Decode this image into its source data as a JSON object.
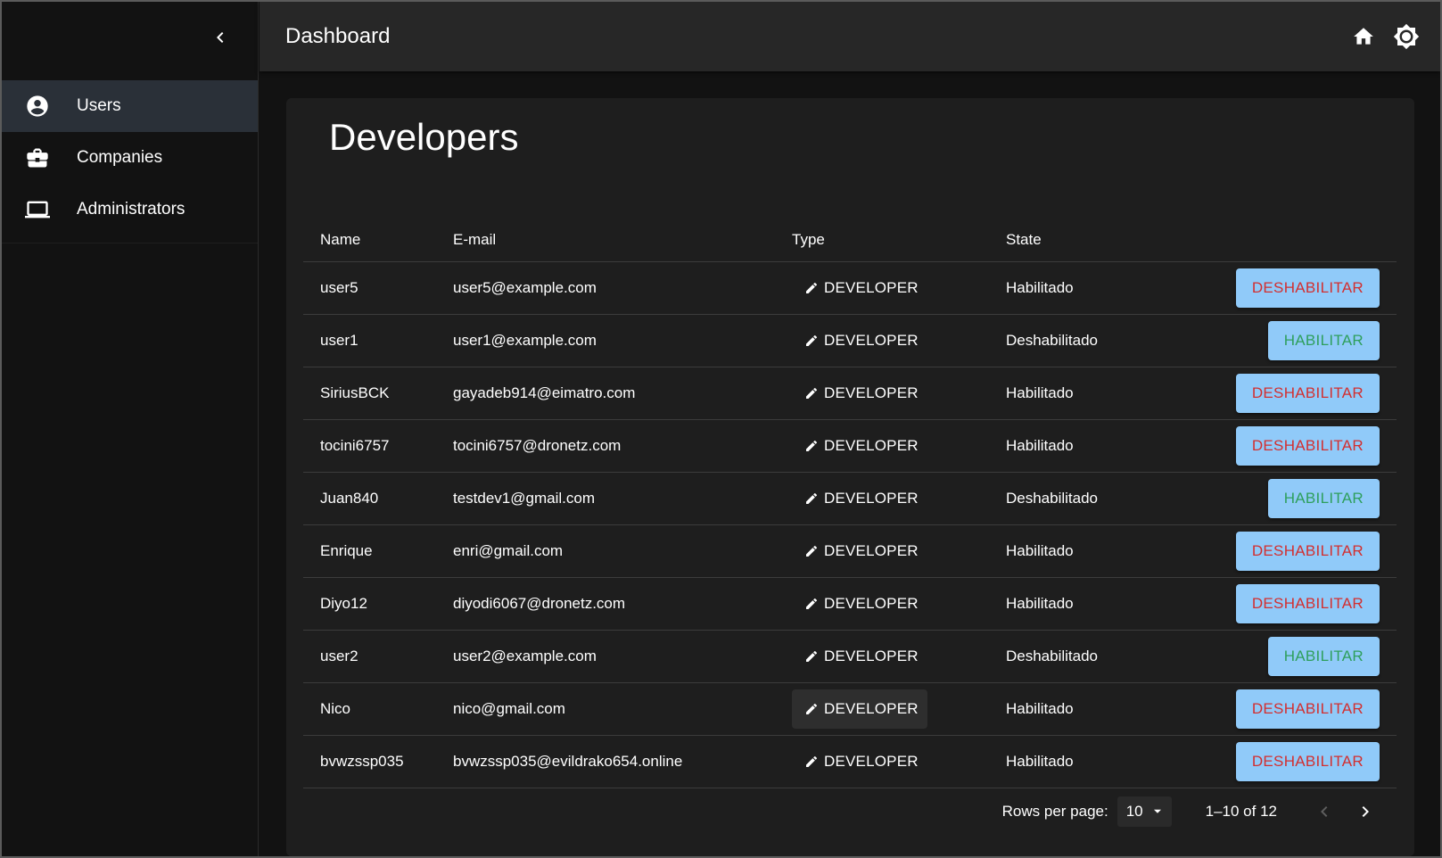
{
  "app": {
    "title": "Dashboard",
    "accent": "#90caf9",
    "danger": "#d32f2f",
    "success": "#2e9f5c"
  },
  "sidebar": {
    "items": [
      {
        "label": "Users",
        "icon": "account-circle-icon",
        "active": true
      },
      {
        "label": "Companies",
        "icon": "briefcase-icon",
        "active": false
      },
      {
        "label": "Administrators",
        "icon": "laptop-icon",
        "active": false
      }
    ]
  },
  "page": {
    "title": "Developers"
  },
  "table": {
    "columns": [
      "Name",
      "E-mail",
      "Type",
      "State"
    ],
    "rows": [
      {
        "name": "user5",
        "email": "user5@example.com",
        "type": "DEVELOPER",
        "state": "Habilitado",
        "action": "DESHABILITAR"
      },
      {
        "name": "user1",
        "email": "user1@example.com",
        "type": "DEVELOPER",
        "state": "Deshabilitado",
        "action": "HABILITAR"
      },
      {
        "name": "SiriusBCK",
        "email": "gayadeb914@eimatro.com",
        "type": "DEVELOPER",
        "state": "Habilitado",
        "action": "DESHABILITAR"
      },
      {
        "name": "tocini6757",
        "email": "tocini6757@dronetz.com",
        "type": "DEVELOPER",
        "state": "Habilitado",
        "action": "DESHABILITAR"
      },
      {
        "name": "Juan840",
        "email": "testdev1@gmail.com",
        "type": "DEVELOPER",
        "state": "Deshabilitado",
        "action": "HABILITAR"
      },
      {
        "name": "Enrique",
        "email": "enri@gmail.com",
        "type": "DEVELOPER",
        "state": "Habilitado",
        "action": "DESHABILITAR"
      },
      {
        "name": "Diyo12",
        "email": "diyodi6067@dronetz.com",
        "type": "DEVELOPER",
        "state": "Habilitado",
        "action": "DESHABILITAR"
      },
      {
        "name": "user2",
        "email": "user2@example.com",
        "type": "DEVELOPER",
        "state": "Deshabilitado",
        "action": "HABILITAR"
      },
      {
        "name": "Nico",
        "email": "nico@gmail.com",
        "type": "DEVELOPER",
        "state": "Habilitado",
        "action": "DESHABILITAR",
        "hovered": true
      },
      {
        "name": "bvwzssp035",
        "email": "bvwzssp035@evildrako654.online",
        "type": "DEVELOPER",
        "state": "Habilitado",
        "action": "DESHABILITAR"
      }
    ]
  },
  "pagination": {
    "rows_per_page_label": "Rows per page:",
    "rows_per_page": "10",
    "range": "1–10 of 12"
  }
}
